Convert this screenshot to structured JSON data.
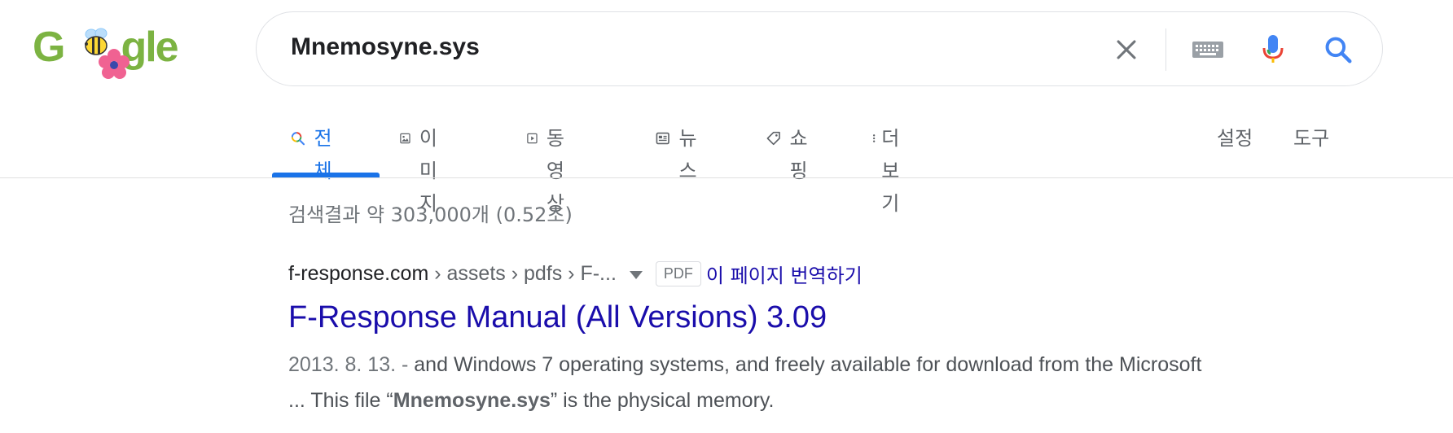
{
  "logo": {
    "text_left": "G",
    "text_right": "gle"
  },
  "search": {
    "query": "Mnemosyne.sys"
  },
  "tabs": [
    {
      "label": "전체",
      "icon": "search-multicolor-icon",
      "active": true
    },
    {
      "label": "이미지",
      "icon": "image-icon",
      "active": false
    },
    {
      "label": "동영상",
      "icon": "play-icon",
      "active": false
    },
    {
      "label": "뉴스",
      "icon": "news-icon",
      "active": false
    },
    {
      "label": "쇼핑",
      "icon": "tag-icon",
      "active": false
    },
    {
      "label": "더보기",
      "icon": "more-vertical-icon",
      "active": false
    }
  ],
  "tools": {
    "settings": "설정",
    "tools": "도구"
  },
  "stats": "검색결과 약 303,000개 (0.52초)",
  "result": {
    "site": "f-response.com",
    "path": " › assets › pdfs › F-...",
    "badge": "PDF",
    "translate": "이 페이지 번역하기",
    "title": "F-Response Manual (All Versions) 3.09",
    "date": "2013. 8. 13. - ",
    "snippet_1": "and Windows 7 operating systems, and freely available for download from the Microsoft",
    "snippet_2_pre": "... This file “",
    "snippet_2_bold": "Mnemosyne.sys",
    "snippet_2_post": "” is the physical memory."
  },
  "colors": {
    "link": "#1a0dab",
    "accent": "#1a73e8",
    "logo_green": "#7cb342"
  }
}
